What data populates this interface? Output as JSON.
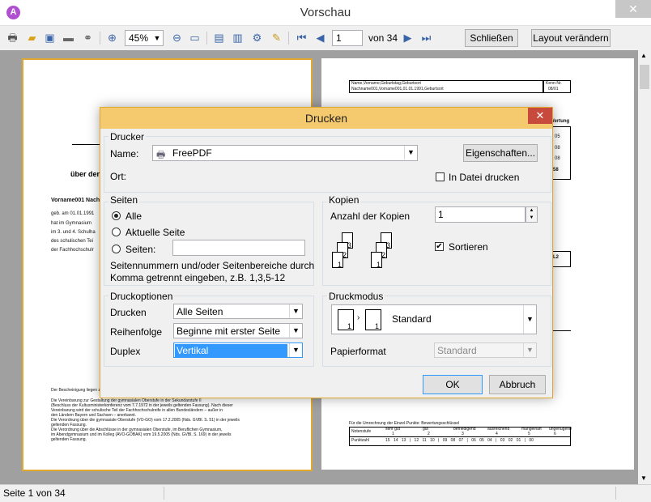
{
  "window": {
    "title": "Vorschau",
    "app_icon_text": "A",
    "close_glyph": "✕"
  },
  "toolbar": {
    "zoom_value": "45%",
    "page_input": "1",
    "page_of": "von 34",
    "close_label": "Schließen",
    "layout_label": "Layout verändern"
  },
  "page1": {
    "heading": "über den",
    "name_line": "Vorname001 Nachn",
    "body_lines": [
      "geb. am 01.01.1991",
      "hat im Gymnasium",
      "im 3. und 4. Schulha",
      "des schulischen Tei",
      "der Fachhochschulr"
    ],
    "footer_lines": [
      "Der Bescheinigung liegen z",
      "Die Vereinbarung zur Gestaltung der gymnasialen Oberstufe in der Sekundarstufe II",
      "(Beschluss der Kultusministerkonferenz vom 7.7.1972 in der jeweils geltenden Fassung). Nach dieser",
      "Vereinbarung wird der schulische Teil der Fachhochschulreife in allen Bundesländern – außer in",
      "den Ländern Bayern und Sachsen – anerkannt.",
      "Die Verordnung über die gymnasiale Oberstufe (VO-GO) vom 17.2.2005 (Nds. GVBl. S. 51) in der jeweils",
      "geltenden Fassung.",
      "Die Verordnung über die Abschlüsse in der gymnasialen Oberstufe, im Beruflichen Gymnasium,",
      "im Abendgymnasium und im Kolleg (AVO-GOBAK) vom 19.5.2005 (Nds. GVBl. S. 169) in der jeweils",
      "geltenden Fassung."
    ]
  },
  "page2": {
    "header_left_1": "Name,Vorname,Geburtstag,Geburtsort",
    "header_left_2": "Nachname001,Vorname001,01.01.1991,Geburtsort",
    "header_right_1": "Kenn-Nr.",
    "header_right_2": "08/01",
    "side_labels": [
      "Wertung",
      "05",
      "08",
      "08",
      "58",
      "L2"
    ],
    "table_title": "Für die Umrechnung der Einzel-Punkte: Bewertungsschlüssel",
    "table_row1_label": "Notenstufe",
    "table_row2_label": "Punktzahl",
    "grades": [
      "sehr gut",
      "gut",
      "befriedigend",
      "ausreichend",
      "mangelhaft",
      "ungenügend"
    ],
    "grade_nums": [
      "1",
      "2",
      "3",
      "4",
      "5",
      "6"
    ],
    "points": "15 14 13 | 12 11 10 | 09 08 07 | 06 05 04 | 03 02 01 | 00"
  },
  "status": {
    "text": "Seite 1 von 34"
  },
  "dialog": {
    "title": "Drucken",
    "close_glyph": "✕",
    "printer": {
      "group_label": "Drucker",
      "name_label": "Name:",
      "name_value": "FreePDF",
      "properties_label": "Eigenschaften...",
      "location_label": "Ort:",
      "print_to_file_label": "In Datei drucken"
    },
    "pages": {
      "group_label": "Seiten",
      "all_label": "Alle",
      "current_label": "Aktuelle Seite",
      "pages_label": "Seiten:",
      "pages_value": "",
      "hint_line1": "Seitennummern und/oder Seitenbereiche durch",
      "hint_line2": "Komma getrennt eingeben, z.B. 1,3,5-12"
    },
    "copies": {
      "group_label": "Kopien",
      "count_label": "Anzahl der Kopien",
      "count_value": "1",
      "collate_label": "Sortieren",
      "collate_checked": true
    },
    "options": {
      "group_label": "Druckoptionen",
      "print_label": "Drucken",
      "print_value": "Alle Seiten",
      "order_label": "Reihenfolge",
      "order_value": "Beginne mit erster Seite",
      "duplex_label": "Duplex",
      "duplex_value": "Vertikal"
    },
    "mode": {
      "group_label": "Druckmodus",
      "mode_value": "Standard",
      "paper_label": "Papierformat",
      "paper_value": "Standard"
    },
    "ok_label": "OK",
    "cancel_label": "Abbruch"
  }
}
